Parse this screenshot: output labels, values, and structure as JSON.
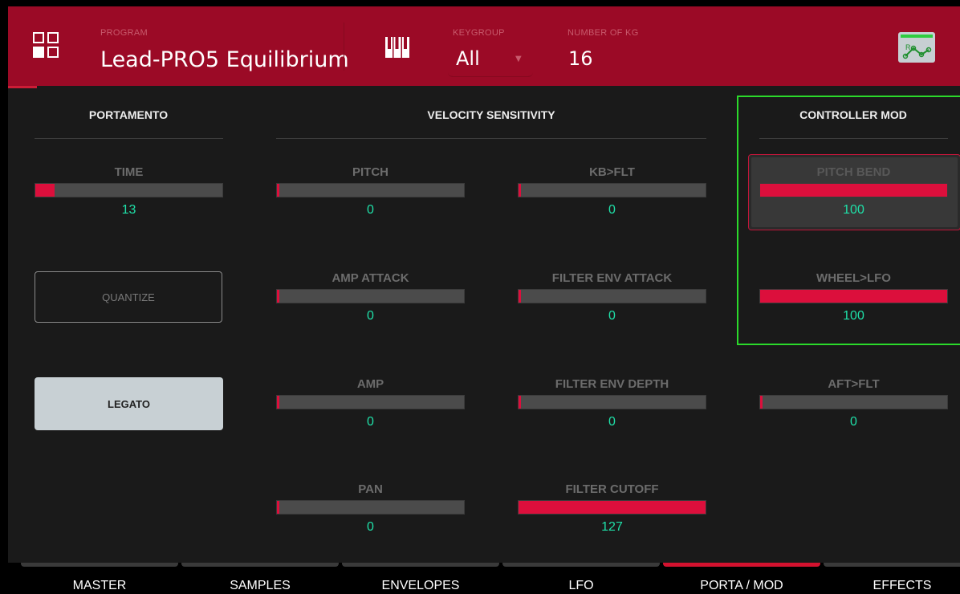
{
  "header": {
    "program_label": "PROGRAM",
    "program_name": "Lead-PRO5 Equilibrium",
    "keygroup_label": "KEYGROUP",
    "keygroup_value": "All",
    "num_kg_label": "NUMBER OF KG",
    "num_kg_value": "16",
    "mod_icon_letter": "R"
  },
  "portamento": {
    "title": "PORTAMENTO",
    "time": {
      "label": "TIME",
      "value": "13",
      "fraction": 0.102
    },
    "quantize_label": "QUANTIZE",
    "legato_label": "LEGATO"
  },
  "velocity": {
    "title": "VELOCITY SENSITIVITY",
    "params": [
      {
        "label": "PITCH",
        "value": "0",
        "fraction": 0
      },
      {
        "label": "KB>FLT",
        "value": "0",
        "fraction": 0
      },
      {
        "label": "AMP ATTACK",
        "value": "0",
        "fraction": 0
      },
      {
        "label": "FILTER ENV ATTACK",
        "value": "0",
        "fraction": 0
      },
      {
        "label": "AMP",
        "value": "0",
        "fraction": 0
      },
      {
        "label": "FILTER ENV DEPTH",
        "value": "0",
        "fraction": 0
      },
      {
        "label": "PAN",
        "value": "0",
        "fraction": 0
      },
      {
        "label": "FILTER CUTOFF",
        "value": "127",
        "fraction": 1.0
      }
    ]
  },
  "controller": {
    "title": "CONTROLLER MOD",
    "params": [
      {
        "label": "PITCH BEND",
        "value": "100",
        "fraction": 1.0
      },
      {
        "label": "WHEEL>LFO",
        "value": "100",
        "fraction": 1.0
      },
      {
        "label": "AFT>FLT",
        "value": "0",
        "fraction": 0
      }
    ]
  },
  "tabs": [
    {
      "label": "MASTER",
      "active": false
    },
    {
      "label": "SAMPLES",
      "active": false
    },
    {
      "label": "ENVELOPES",
      "active": false
    },
    {
      "label": "LFO",
      "active": false
    },
    {
      "label": "PORTA / MOD",
      "active": true
    },
    {
      "label": "EFFECTS",
      "active": false
    }
  ],
  "colors": {
    "header_bg": "#9b0a26",
    "fill": "#dc0f3c",
    "value_text": "#1fe0a8",
    "selection_outline": "#2bd92b"
  }
}
